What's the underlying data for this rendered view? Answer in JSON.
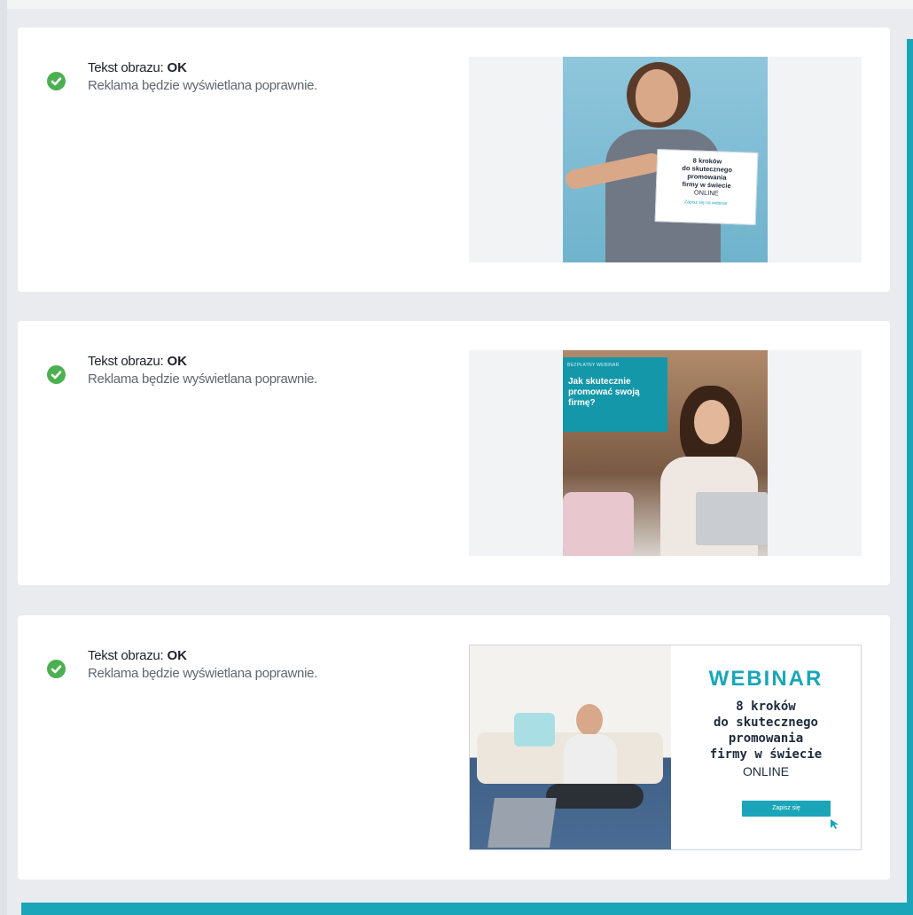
{
  "colors": {
    "accent": "#1aa6b8",
    "ok_green": "#4caf50"
  },
  "items": [
    {
      "status_label": "Tekst obrazu:",
      "status_value": "OK",
      "description": "Reklama będzie wyświetlana poprawnie.",
      "icon": "check-circle-icon",
      "ad": {
        "lines": [
          "8 kroków",
          "do skutecznego",
          "promowania",
          "firmy w świecie"
        ],
        "online": "ONLINE",
        "cta": "Zapisz się na webinar"
      }
    },
    {
      "status_label": "Tekst obrazu:",
      "status_value": "OK",
      "description": "Reklama będzie wyświetlana poprawnie.",
      "icon": "check-circle-icon",
      "ad": {
        "top_label": "BEZPŁATNY WEBINAR",
        "title": "Jak skutecznie promować swoją firmę?"
      }
    },
    {
      "status_label": "Tekst obrazu:",
      "status_value": "OK",
      "description": "Reklama będzie wyświetlana poprawnie.",
      "icon": "check-circle-icon",
      "ad": {
        "heading": "WEBINAR",
        "lines": [
          "8 kroków",
          "do skutecznego",
          "promowania",
          "firmy w świecie"
        ],
        "online": "ONLINE",
        "cta": "Zapisz się"
      }
    }
  ]
}
